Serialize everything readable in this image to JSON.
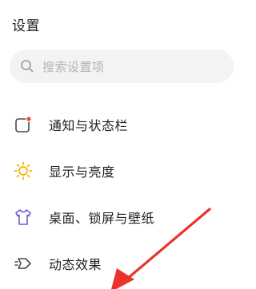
{
  "header": {
    "title": "设置"
  },
  "search": {
    "placeholder": "搜索设置项"
  },
  "settings": {
    "items": [
      {
        "label": "通知与状态栏",
        "icon": "notification-bell-icon"
      },
      {
        "label": "显示与亮度",
        "icon": "sun-icon"
      },
      {
        "label": "桌面、锁屏与壁纸",
        "icon": "tshirt-icon"
      },
      {
        "label": "动态效果",
        "icon": "motion-tag-icon"
      }
    ]
  },
  "colors": {
    "accent": "#e8342d",
    "notification_dot": "#e94a3f",
    "sun_icon": "#f0b400",
    "tshirt_icon": "#6a5acd"
  }
}
